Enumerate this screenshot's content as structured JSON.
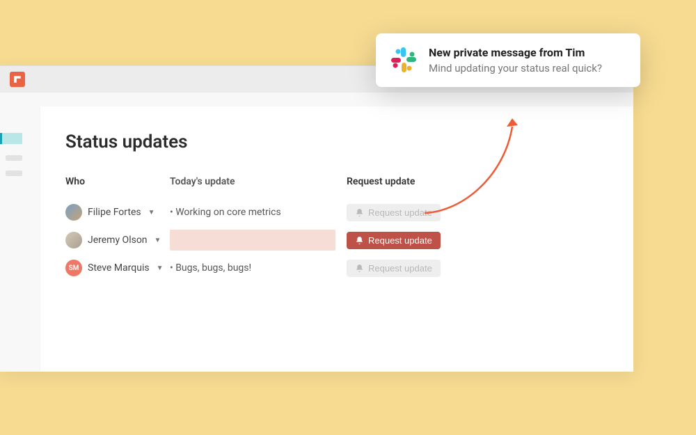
{
  "notification": {
    "title": "New private message from Tim",
    "body": "Mind updating your status real quick?"
  },
  "page": {
    "title": "Status updates",
    "columns": {
      "who": "Who",
      "update": "Today's update",
      "request": "Request update"
    }
  },
  "rows": [
    {
      "name": "Filipe Fortes",
      "initials": "",
      "update": "Working on core metrics",
      "request_label": "Request update",
      "request_active": false
    },
    {
      "name": "Jeremy Olson",
      "initials": "",
      "update": "",
      "request_label": "Request update",
      "request_active": true
    },
    {
      "name": "Steve Marquis",
      "initials": "SM",
      "update": "Bugs, bugs, bugs!",
      "request_label": "Request update",
      "request_active": false
    }
  ],
  "colors": {
    "accent": "#EB6345",
    "request_active_bg": "#BE5148",
    "empty_cell_bg": "#F6DDD6",
    "page_bg": "#F6DB91"
  }
}
